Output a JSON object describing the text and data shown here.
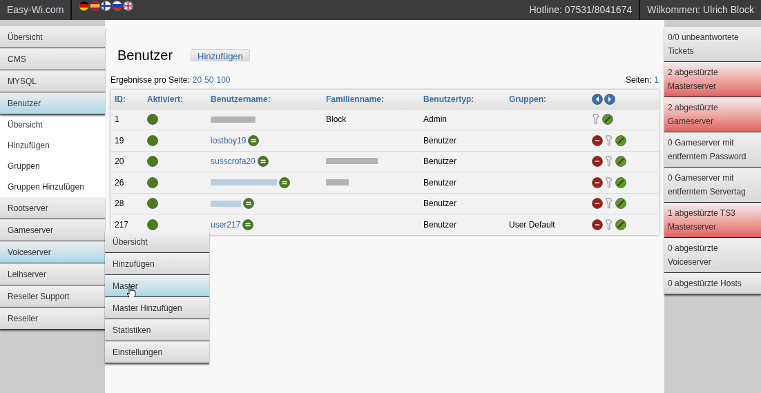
{
  "topbar": {
    "brand": "Easy-Wi.com",
    "flags": [
      {
        "kind": "de"
      },
      {
        "kind": "es"
      },
      {
        "kind": "fi"
      },
      {
        "kind": "ru"
      },
      {
        "kind": "uk"
      }
    ],
    "hotline": "Hotline: 07531/8041674",
    "welcome": "Wilkommen: Ulrich Block"
  },
  "sidebar": {
    "items": [
      {
        "label": "Übersicht",
        "selected": false
      },
      {
        "label": "CMS",
        "selected": false
      },
      {
        "label": "MYSQL",
        "selected": false
      },
      {
        "label": "Benutzer",
        "selected": true,
        "children": [
          {
            "label": "Übersicht"
          },
          {
            "label": "Hinzufügen"
          },
          {
            "label": "Gruppen"
          },
          {
            "label": "Gruppen Hinzufügen"
          }
        ]
      },
      {
        "label": "Rootserver",
        "selected": false
      },
      {
        "label": "Gameserver",
        "selected": false
      },
      {
        "label": "Voiceserver",
        "selected": true,
        "flyout": [
          {
            "label": "Übersicht",
            "selected": false
          },
          {
            "label": "Hinzufügen",
            "selected": false
          },
          {
            "label": "Master",
            "selected": true
          },
          {
            "label": "Master Hinzufügen",
            "selected": false
          },
          {
            "label": "Statistiken",
            "selected": false
          },
          {
            "label": "Einstellungen",
            "selected": false
          }
        ]
      },
      {
        "label": "Leihserver",
        "selected": false
      },
      {
        "label": "Reseller Support",
        "selected": false
      },
      {
        "label": "Reseller",
        "selected": false
      }
    ]
  },
  "main": {
    "title": "Benutzer",
    "add_button": "Hinzufügen",
    "per_page_label": "Ergebnisse pro Seite:",
    "per_page_options": [
      "20",
      "50",
      "100"
    ],
    "pages_label": "Seiten:",
    "pages": [
      "1"
    ],
    "table": {
      "columns": [
        "ID:",
        "Aktiviert:",
        "Benutzername:",
        "Familienname:",
        "Benutzertyp:",
        "Gruppen:"
      ],
      "rows": [
        {
          "id": "1",
          "active": true,
          "username": {
            "redacted": true
          },
          "family": {
            "text": "Block"
          },
          "type": "Admin",
          "deletable": false
        },
        {
          "id": "19",
          "active": true,
          "username": {
            "text": "lostboy19"
          },
          "type": "Benutzer",
          "deletable": true
        },
        {
          "id": "20",
          "active": true,
          "username": {
            "text": "susscrofa20"
          },
          "family": {
            "redacted": true
          },
          "type": "Benutzer",
          "deletable": true
        },
        {
          "id": "26",
          "active": true,
          "username": {
            "redacted": true
          },
          "family": {
            "redacted": true
          },
          "type": "Benutzer",
          "deletable": true
        },
        {
          "id": "28",
          "active": true,
          "username": {
            "redacted": true
          },
          "type": "Benutzer",
          "deletable": true
        },
        {
          "id": "217",
          "active": true,
          "username": {
            "text": "user217"
          },
          "type": "Benutzer",
          "groups": "User Default",
          "deletable": true
        }
      ]
    }
  },
  "notices": [
    {
      "text": "0/0 unbeantwortete Tickets",
      "alert": false
    },
    {
      "text": "2 abgestürzte Masterserver",
      "alert": true
    },
    {
      "text": "2 abgestürzte Gameserver",
      "alert": true
    },
    {
      "text": "0 Gameserver mit entferntem Password",
      "alert": false
    },
    {
      "text": "0 Gameserver mit entferntem Servertag",
      "alert": false
    },
    {
      "text": "1 abgestürzte TS3 Masterserver",
      "alert": true
    },
    {
      "text": "0 abgestürzte Voiceserver",
      "alert": false
    },
    {
      "text": "0 abgestürzte Hosts",
      "alert": false
    }
  ]
}
